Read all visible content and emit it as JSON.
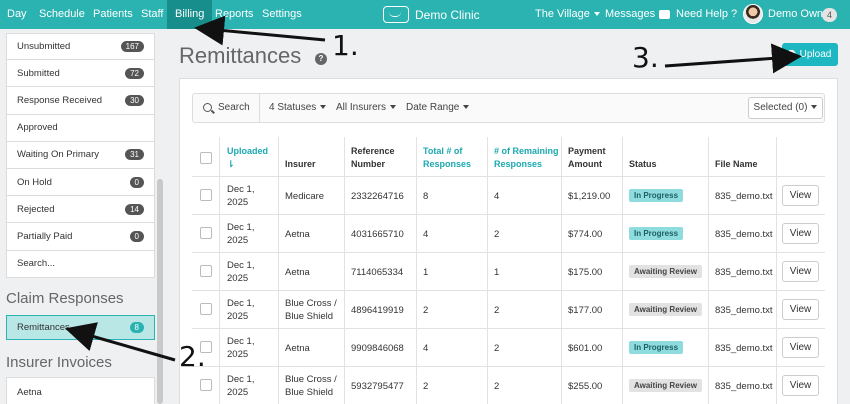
{
  "nav": {
    "items": [
      "Day",
      "Schedule",
      "Patients",
      "Staff",
      "Billing",
      "Reports",
      "Settings"
    ],
    "brand": "Demo Clinic",
    "location": "The Village",
    "messages": "Messages",
    "help": "Need Help ?",
    "user": "Demo Owner",
    "user_count": "4"
  },
  "sidebar": {
    "items": [
      {
        "label": "Unsubmitted",
        "count": "167"
      },
      {
        "label": "Submitted",
        "count": "72"
      },
      {
        "label": "Response Received",
        "count": "30"
      },
      {
        "label": "Approved",
        "count": ""
      },
      {
        "label": "Waiting On Primary",
        "count": "31"
      },
      {
        "label": "On Hold",
        "count": "0"
      },
      {
        "label": "Rejected",
        "count": "14"
      },
      {
        "label": "Partially Paid",
        "count": "0"
      },
      {
        "label": "Search...",
        "count": ""
      }
    ],
    "section_claims": "Claim Responses",
    "remittances": {
      "label": "Remittances",
      "count": "8"
    },
    "section_invoices": "Insurer Invoices",
    "aetna": "Aetna"
  },
  "main": {
    "title": "Remittances",
    "upload": "Upload",
    "filters": {
      "search": "Search",
      "statuses": "4 Statuses",
      "insurers": "All Insurers",
      "date_range": "Date Range",
      "selected": "Selected (0)"
    },
    "headers": {
      "uploaded": "Uploaded",
      "insurer": "Insurer",
      "reference": "Reference Number",
      "total": "Total # of Responses",
      "remaining": "# of Remaining Responses",
      "payment": "Payment Amount",
      "status": "Status",
      "file": "File Name"
    },
    "rows": [
      {
        "date1": "Dec 1,",
        "date2": "2025",
        "insurer1": "Medicare",
        "insurer2": "",
        "ref": "2332264716",
        "total": "8",
        "remaining": "4",
        "amount": "$1,219.00",
        "status": "In Progress",
        "file": "835_demo.txt",
        "view": "View"
      },
      {
        "date1": "Dec 1,",
        "date2": "2025",
        "insurer1": "Aetna",
        "insurer2": "",
        "ref": "4031665710",
        "total": "4",
        "remaining": "2",
        "amount": "$774.00",
        "status": "In Progress",
        "file": "835_demo.txt",
        "view": "View"
      },
      {
        "date1": "Dec 1,",
        "date2": "2025",
        "insurer1": "Aetna",
        "insurer2": "",
        "ref": "7114065334",
        "total": "1",
        "remaining": "1",
        "amount": "$175.00",
        "status": "Awaiting Review",
        "file": "835_demo.txt",
        "view": "View"
      },
      {
        "date1": "Dec 1,",
        "date2": "2025",
        "insurer1": "Blue Cross /",
        "insurer2": "Blue Shield",
        "ref": "4896419919",
        "total": "2",
        "remaining": "2",
        "amount": "$177.00",
        "status": "Awaiting Review",
        "file": "835_demo.txt",
        "view": "View"
      },
      {
        "date1": "Dec 1,",
        "date2": "2025",
        "insurer1": "Aetna",
        "insurer2": "",
        "ref": "9909846068",
        "total": "4",
        "remaining": "2",
        "amount": "$601.00",
        "status": "In Progress",
        "file": "835_demo.txt",
        "view": "View"
      },
      {
        "date1": "Dec 1,",
        "date2": "2025",
        "insurer1": "Blue Cross /",
        "insurer2": "Blue Shield",
        "ref": "5932795477",
        "total": "2",
        "remaining": "2",
        "amount": "$255.00",
        "status": "Awaiting Review",
        "file": "835_demo.txt",
        "view": "View"
      }
    ]
  },
  "annotations": {
    "a1": "1.",
    "a2": "2.",
    "a3": "3."
  },
  "colors": {
    "accent": "#2ab3b1",
    "accent_dark": "#178e8c",
    "upload": "#1cb7c0"
  }
}
